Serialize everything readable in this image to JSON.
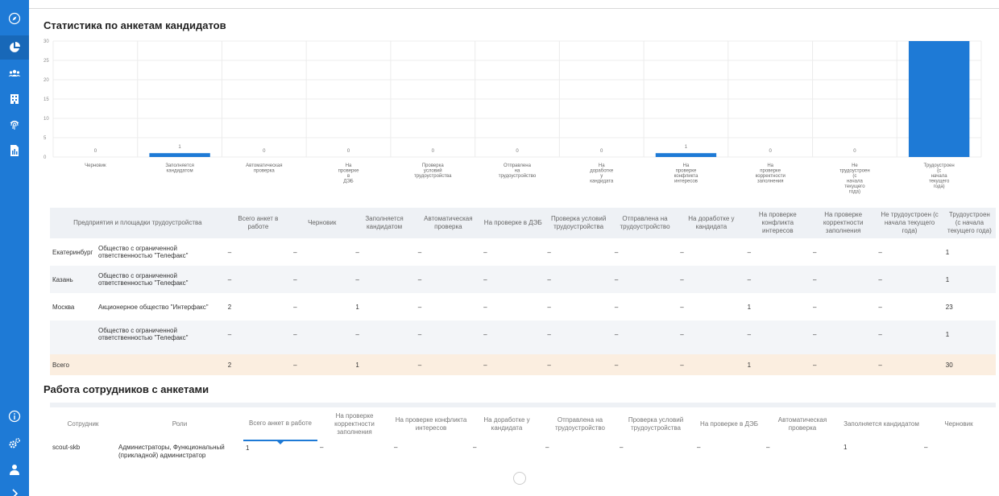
{
  "sidebar": {
    "top_icons": [
      "compass-icon",
      "pie-chart-icon",
      "users-icon",
      "building-icon",
      "fingerprint-icon",
      "document-icon"
    ],
    "bottom_icons": [
      "info-icon",
      "settings-icon",
      "user-icon",
      "expand-icon"
    ]
  },
  "chart_section": {
    "title": "Статистика по анкетам кандидатов"
  },
  "chart_data": {
    "type": "bar",
    "categories": [
      [
        "Черновик"
      ],
      [
        "Заполняется",
        "кандидатом"
      ],
      [
        "Автоматическая",
        "проверка"
      ],
      [
        "На",
        "проверке",
        "в",
        "ДЭБ"
      ],
      [
        "Проверка",
        "условий",
        "трудоустройства"
      ],
      [
        "Отправлена",
        "на",
        "трудоустройство"
      ],
      [
        "На",
        "доработке",
        "у",
        "кандидата"
      ],
      [
        "На",
        "проверке",
        "конфликта",
        "интересов"
      ],
      [
        "На",
        "проверке",
        "корректности",
        "заполнения"
      ],
      [
        "Не",
        "трудоустроен",
        "(с",
        "начала",
        "текущего",
        "года)"
      ],
      [
        "Трудоустроен",
        "(с",
        "начала",
        "текущего",
        "года)"
      ]
    ],
    "values": [
      0,
      1,
      0,
      0,
      0,
      0,
      0,
      1,
      0,
      0,
      30
    ],
    "ylim": [
      0,
      30
    ],
    "yticks": [
      0,
      5,
      10,
      15,
      20,
      25,
      30
    ],
    "grid": true,
    "bar_color": "#1e7ad6"
  },
  "table1": {
    "headers": {
      "org": "Предприятия и площадки трудоустройства",
      "total": "Всего анкет в работе",
      "c1": "Черновик",
      "c2": "Заполняется кандидатом",
      "c3": "Автоматическая проверка",
      "c4": "На проверке в ДЭБ",
      "c5": "Проверка условий трудоустройства",
      "c6": "Отправлена на трудоустройство",
      "c7": "На доработке у кандидата",
      "c8": "На проверке конфликта интересов",
      "c9": "На проверке корректности заполнения",
      "c10": "Не трудоустроен (с начала текущего года)",
      "c11": "Трудоустроен (с начала текущего года)"
    },
    "rows": [
      {
        "city": "Екатеринбург",
        "org": "Общество с ограниченной ответственностью \"Телефакс\"",
        "vals": [
          "–",
          "–",
          "–",
          "–",
          "–",
          "–",
          "–",
          "–",
          "–",
          "–",
          "–",
          "1"
        ]
      },
      {
        "city": "Казань",
        "org": "Общество с ограниченной ответственностью \"Телефакс\"",
        "vals": [
          "–",
          "–",
          "–",
          "–",
          "–",
          "–",
          "–",
          "–",
          "–",
          "–",
          "–",
          "1"
        ]
      },
      {
        "city": "Москва",
        "org": "Акционерное общество \"Интерфакс\"",
        "vals": [
          "2",
          "–",
          "1",
          "–",
          "–",
          "–",
          "–",
          "–",
          "1",
          "–",
          "–",
          "23"
        ]
      },
      {
        "city": "",
        "org": "Общество с ограниченной ответственностью \"Телефакс\"",
        "vals": [
          "–",
          "–",
          "–",
          "–",
          "–",
          "–",
          "–",
          "–",
          "–",
          "–",
          "–",
          "1"
        ]
      }
    ],
    "total": {
      "label": "Всего",
      "vals": [
        "2",
        "–",
        "1",
        "–",
        "–",
        "–",
        "–",
        "–",
        "1",
        "–",
        "–",
        "30"
      ]
    }
  },
  "employees_section": {
    "title": "Работа сотрудников с анкетами"
  },
  "table2": {
    "headers": {
      "employee": "Сотрудник",
      "roles": "Роли",
      "total": "Всего анкет в работе",
      "c1": "На проверке корректности заполнения",
      "c2": "На проверке конфликта интересов",
      "c3": "На доработке у кандидата",
      "c4": "Отправлена на трудоустройство",
      "c5": "Проверка условий трудоустройства",
      "c6": "На проверке в ДЭБ",
      "c7": "Автоматическая проверка",
      "c8": "Заполняется кандидатом",
      "c9": "Черновик"
    },
    "rows": [
      {
        "employee": "scout-skb",
        "roles": "Администраторы, Функциональный (прикладной) администратор",
        "vals": [
          "1",
          "–",
          "–",
          "–",
          "–",
          "–",
          "–",
          "–",
          "1",
          "–"
        ]
      }
    ]
  }
}
